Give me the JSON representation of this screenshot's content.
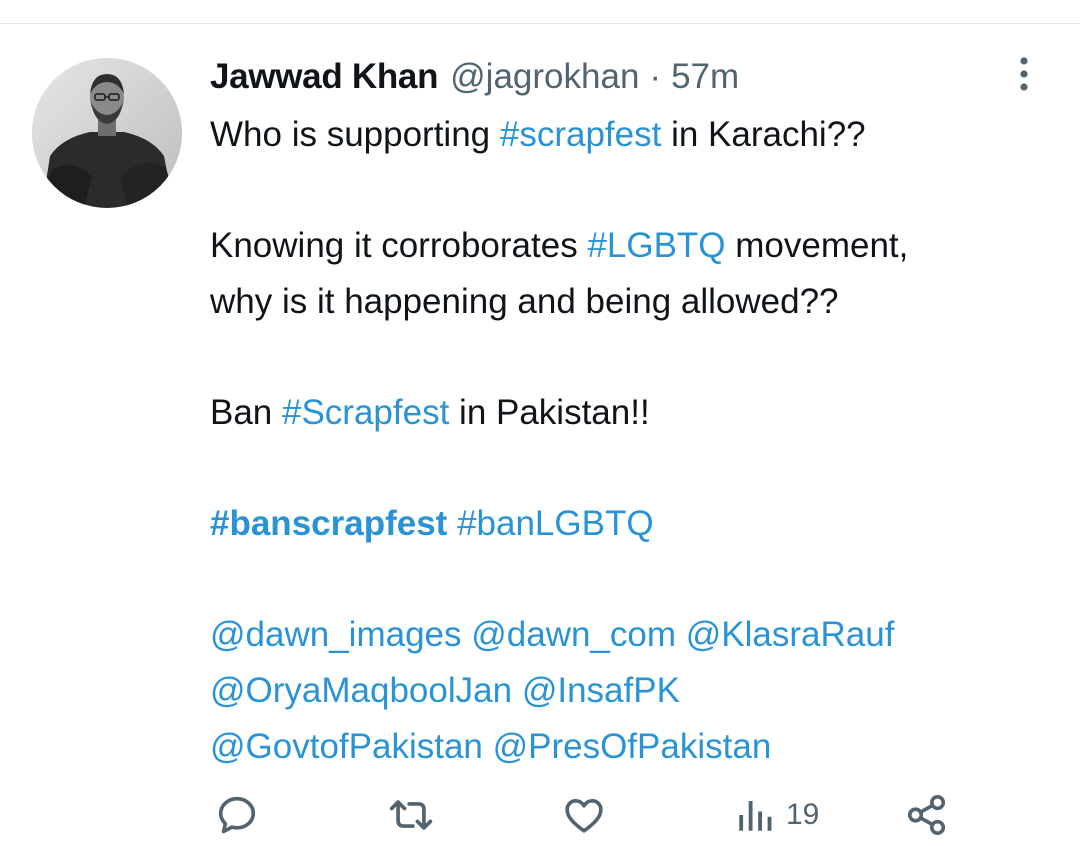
{
  "tweet": {
    "author_name": "Jawwad Khan",
    "author_handle": "@jagrokhan",
    "separator": "·",
    "time": "57m",
    "lines": {
      "l1": {
        "t1": "Who is supporting ",
        "h1": "#scrapfest",
        "t2": " in Karachi??"
      },
      "l2": {
        "t1": "Knowing it corroborates ",
        "h1": "#LGBTQ",
        "t2": " movement,"
      },
      "l3": {
        "t1": "why is it happening and being allowed??"
      },
      "l4": {
        "t1": "Ban ",
        "h1": "#Scrapfest",
        "t2": " in Pakistan!!"
      },
      "l5": {
        "h1": "#banscrapfest",
        "h2": "#banLGBTQ"
      },
      "l6": {
        "m1": "@dawn_images",
        "m2": "@dawn_com",
        "m3": "@KlasraRauf"
      },
      "l7": {
        "m1": "@OryaMaqboolJan",
        "m2": "@InsafPK"
      },
      "l8": {
        "m1": "@GovtofPakistan",
        "m2": "@PresOfPakistan"
      }
    }
  },
  "actions": {
    "views_count": "19",
    "icons": [
      "reply-icon",
      "retweet-icon",
      "like-icon",
      "views-icon",
      "share-icon"
    ]
  },
  "colors": {
    "link": "#2a93d5",
    "text": "#0f1419",
    "secondary": "#536471"
  }
}
